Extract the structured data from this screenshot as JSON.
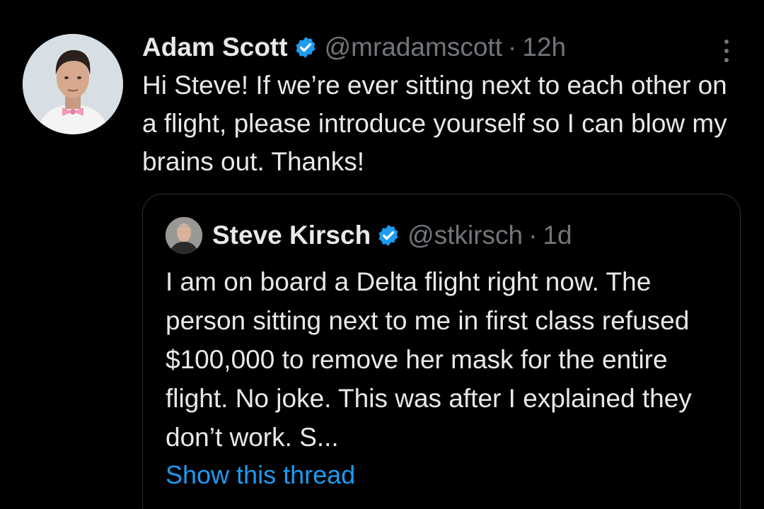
{
  "tweet": {
    "author_name": "Adam Scott",
    "handle": "@mradamscott",
    "separator": "·",
    "time": "12h",
    "text": "Hi Steve! If we’re ever sitting next to each other on a flight, please introduce yourself so I can blow my brains out. Thanks!"
  },
  "quoted": {
    "author_name": "Steve Kirsch",
    "handle": "@stkirsch",
    "separator": "·",
    "time": "1d",
    "text": "I am on board a Delta flight right now. The person sitting next to me in first class refused $100,000 to remove her mask for the entire flight. No joke. This was after I explained they don’t work. S...",
    "show_thread_label": "Show this thread"
  },
  "colors": {
    "background": "#000000",
    "primary_text": "#e7e9ea",
    "secondary_text": "#71767b",
    "link": "#1d9bf0",
    "verified_badge": "#1d9bf0",
    "border": "#2f3336"
  },
  "icons": {
    "verified": "verified-badge-icon",
    "more": "more-options-icon"
  }
}
